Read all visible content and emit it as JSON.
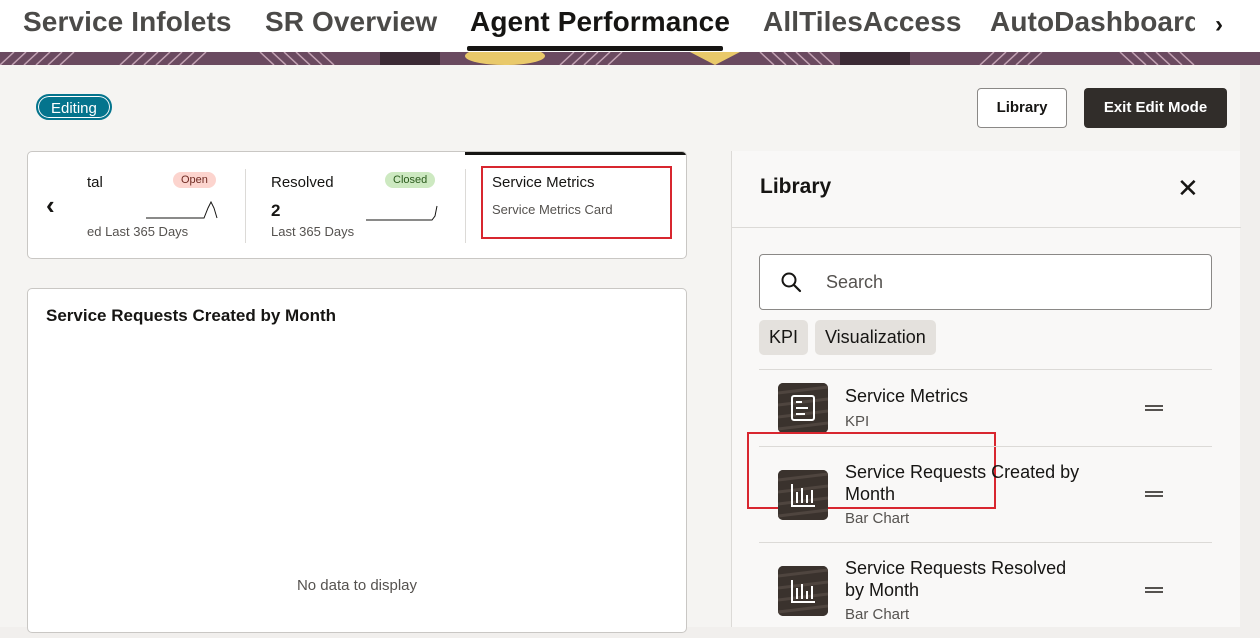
{
  "tabs": [
    {
      "label": "Service Infolets"
    },
    {
      "label": "SR Overview"
    },
    {
      "label": "Agent Performance"
    },
    {
      "label": "AllTilesAccess"
    },
    {
      "label": "AutoDashboard"
    }
  ],
  "editing_badge": "Editing",
  "toolbar": {
    "library_label": "Library",
    "exit_label": "Exit Edit Mode"
  },
  "kpis": [
    {
      "title": "tal",
      "pill": "Open",
      "value": "",
      "subtitle": "ed Last 365 Days"
    },
    {
      "title": "Resolved",
      "pill": "Closed",
      "value": "2",
      "subtitle": "Last 365 Days"
    },
    {
      "title": "Service Metrics",
      "subtitle": "Service Metrics Card"
    }
  ],
  "chart_card": {
    "title": "Service Requests Created by Month",
    "empty_message": "No data to display"
  },
  "library": {
    "title": "Library",
    "search_placeholder": "Search",
    "chips": [
      "KPI",
      "Visualization"
    ],
    "items": [
      {
        "name": "Service Metrics",
        "type": "KPI",
        "icon": "kpi-card-icon"
      },
      {
        "name": "Service Requests Created by Month",
        "type": "Bar Chart",
        "icon": "bar-chart-icon"
      },
      {
        "name": "Service Requests Resolved by Month",
        "type": "Bar Chart",
        "icon": "bar-chart-icon"
      }
    ]
  },
  "colors": {
    "accent": "#04748d",
    "highlight": "#d8262f",
    "dark_button": "#312d2a"
  }
}
